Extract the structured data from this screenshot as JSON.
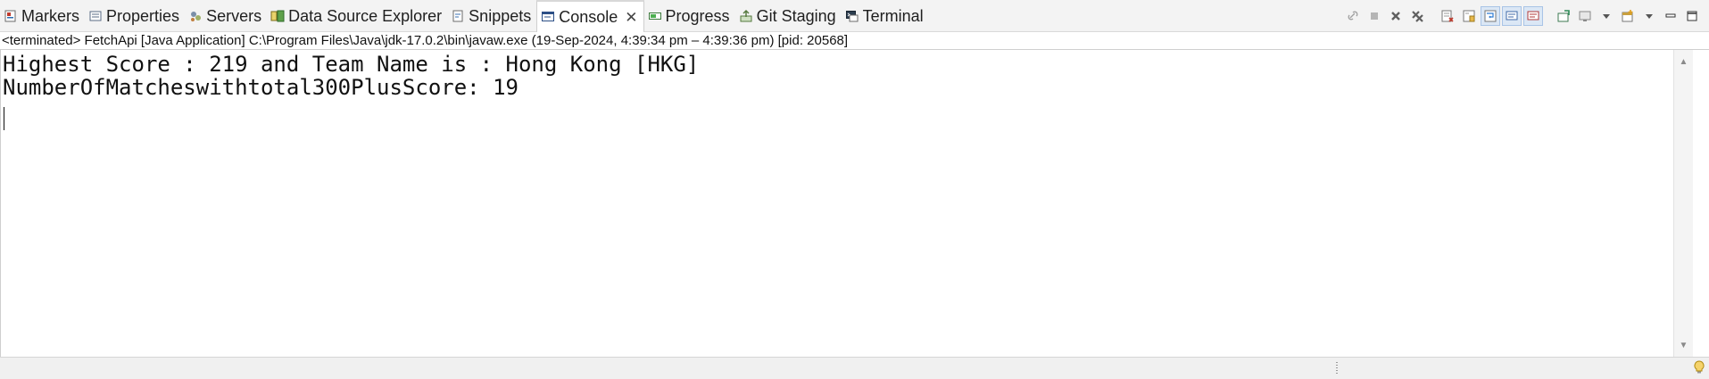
{
  "tabs": [
    {
      "label": "Markers",
      "icon": "markers-icon"
    },
    {
      "label": "Properties",
      "icon": "properties-icon"
    },
    {
      "label": "Servers",
      "icon": "servers-icon"
    },
    {
      "label": "Data Source Explorer",
      "icon": "data-source-explorer-icon"
    },
    {
      "label": "Snippets",
      "icon": "snippets-icon"
    },
    {
      "label": "Console",
      "icon": "console-icon",
      "active": true,
      "close": "✕"
    },
    {
      "label": "Progress",
      "icon": "progress-icon"
    },
    {
      "label": "Git Staging",
      "icon": "git-staging-icon"
    },
    {
      "label": "Terminal",
      "icon": "terminal-icon"
    }
  ],
  "status_line": "<terminated> FetchApi [Java Application] C:\\Program Files\\Java\\jdk-17.0.2\\bin\\javaw.exe  (19-Sep-2024, 4:39:34 pm – 4:39:36 pm) [pid: 20568]",
  "console": {
    "lines": [
      "Highest Score : 219 and Team Name is : Hong Kong [HKG]",
      "NumberOfMatcheswithtotal300PlusScore: 19"
    ]
  },
  "toolbar_icons": [
    "link-icon",
    "stop-icon",
    "remove-launch-icon",
    "remove-all-terminated-icon",
    "clear-console-icon",
    "scroll-lock-icon",
    "word-wrap-icon",
    "show-on-stdout-icon",
    "show-on-stderr-icon",
    "pin-console-icon",
    "display-console-icon",
    "dropdown-icon",
    "open-console-icon",
    "dropdown-icon",
    "minimize-icon",
    "maximize-icon"
  ],
  "colors": {
    "active_tab_bg": "#ffffff",
    "tabbar_bg": "#f3f3f3",
    "pressed_button": "#dbe7f5"
  }
}
